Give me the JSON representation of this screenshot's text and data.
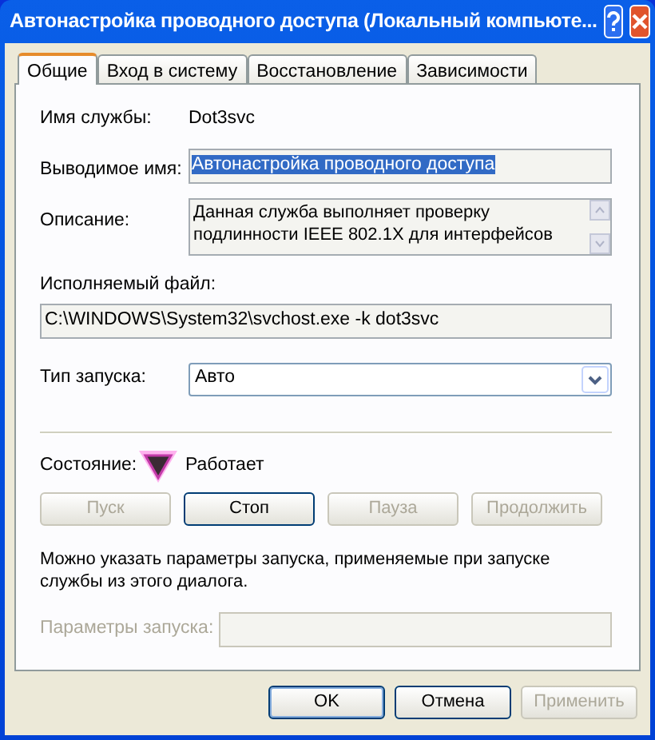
{
  "window": {
    "title": "Автонастройка проводного доступа (Локальный компьюте..."
  },
  "tabs": [
    {
      "label": "Общие",
      "selected": true
    },
    {
      "label": "Вход в систему",
      "selected": false
    },
    {
      "label": "Восстановление",
      "selected": false
    },
    {
      "label": "Зависимости",
      "selected": false
    }
  ],
  "service_name": {
    "label": "Имя службы:",
    "value": "Dot3svc"
  },
  "display_name": {
    "label": "Выводимое имя:",
    "value": "Автонастройка проводного доступа",
    "text_selected": true
  },
  "description": {
    "label": "Описание:",
    "value": "Данная служба выполняет проверку подлинности IEEE 802.1X для интерфейсов"
  },
  "executable": {
    "label": "Исполняемый файл:",
    "value": "C:\\WINDOWS\\System32\\svchost.exe -k dot3svc"
  },
  "startup_type": {
    "label": "Тип запуска:",
    "value": "Авто"
  },
  "status": {
    "label": "Состояние:",
    "value": "Работает"
  },
  "control_buttons": [
    {
      "label": "Пуск",
      "disabled": true
    },
    {
      "label": "Стоп",
      "disabled": false
    },
    {
      "label": "Пауза",
      "disabled": true
    },
    {
      "label": "Продолжить",
      "disabled": true
    }
  ],
  "hint": "Можно указать параметры запуска, применяемые при запуске службы из этого диалога.",
  "start_parameters": {
    "label": "Параметры запуска:",
    "disabled": true
  },
  "dialog_buttons": [
    {
      "label": "OK",
      "disabled": false,
      "default": true
    },
    {
      "label": "Отмена",
      "disabled": false,
      "default": false
    },
    {
      "label": "Применить",
      "disabled": true,
      "default": false
    }
  ]
}
